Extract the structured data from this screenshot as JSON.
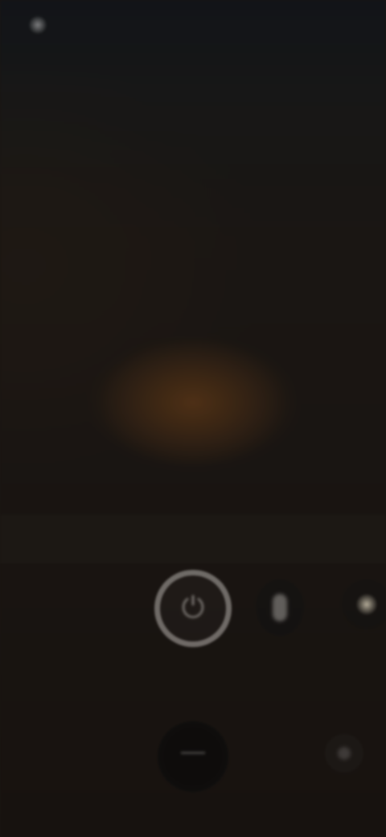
{
  "status_bar": {
    "indicator_icon": "notification-dot-icon",
    "text": ""
  },
  "lock_screen": {
    "date_text": "",
    "time_text": ""
  },
  "quick_actions": [
    {
      "name": "power",
      "icon": "power-icon",
      "label": ""
    },
    {
      "name": "mode",
      "icon": "mode-icon",
      "label": ""
    },
    {
      "name": "light",
      "icon": "light-icon",
      "label": ""
    }
  ],
  "bottom_bar": {
    "home_icon": "home-icon",
    "corner_icon": "menu-icon"
  },
  "colors": {
    "background": "#1b1612",
    "accent_orange": "#c9823c",
    "ring": "#d7d2cd"
  }
}
